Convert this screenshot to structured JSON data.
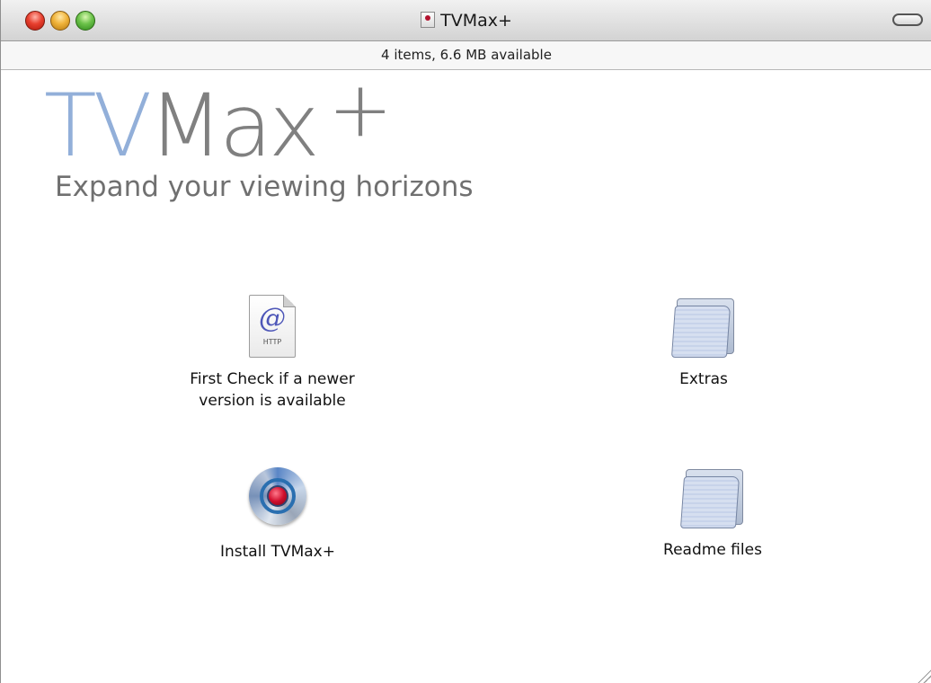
{
  "window": {
    "title": "TVMax+",
    "status": "4 items, 6.6 MB available"
  },
  "logo": {
    "part1": "TV",
    "part2": "Max",
    "plus": "+",
    "tagline": "Expand your viewing horizons"
  },
  "items": [
    {
      "label_line1": "First Check if a newer",
      "label_line2": "version is available",
      "icon": "http-document-icon",
      "icon_symbol": "@",
      "icon_caption": "HTTP"
    },
    {
      "label": "Extras",
      "icon": "folder-icon"
    },
    {
      "label": "Install TVMax+",
      "icon": "installer-icon"
    },
    {
      "label": "Readme files",
      "icon": "folder-icon"
    }
  ],
  "colors": {
    "logo_tv": "#92afd9",
    "logo_max": "#808080",
    "close": "#e8402f",
    "minimize": "#f0b33a",
    "zoom": "#6cc24a"
  }
}
